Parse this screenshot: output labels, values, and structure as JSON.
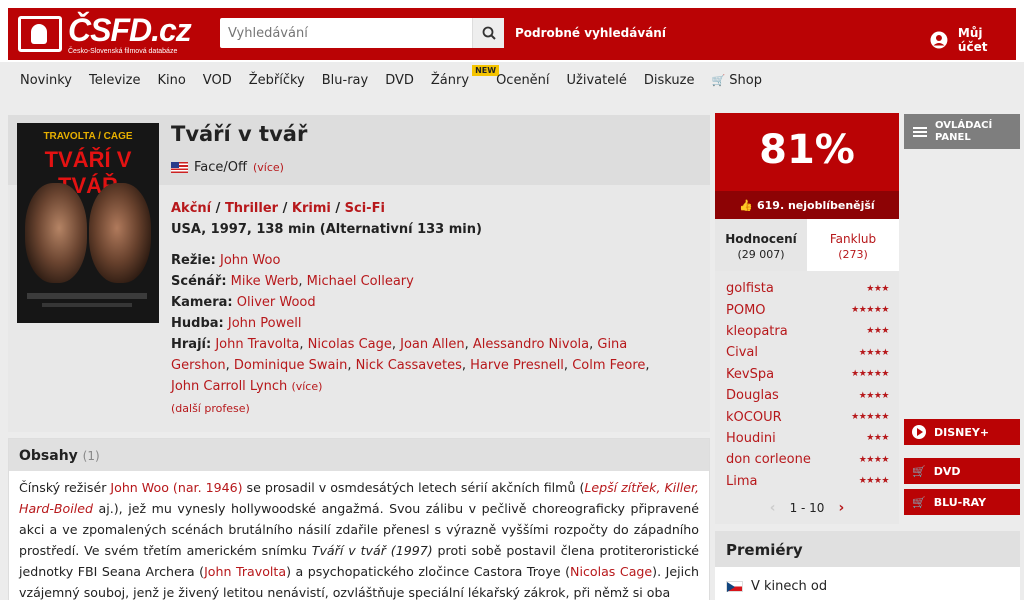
{
  "header": {
    "logo_text": "ČSFD.cz",
    "logo_sub": "Česko-Slovenská filmová databáze",
    "search_placeholder": "Vyhledávání",
    "advanced_search": "Podrobné vyhledávání",
    "account": "Můj účet",
    "brand_color": "#ba0305"
  },
  "nav": {
    "items": [
      "Novinky",
      "Televize",
      "Kino",
      "VOD",
      "Žebříčky",
      "Blu-ray",
      "DVD",
      "Žánry",
      "Ocenění",
      "Uživatelé",
      "Diskuze",
      "Shop"
    ],
    "badge": "NEW"
  },
  "film": {
    "poster_top": "TRAVOLTA / CAGE",
    "poster_title": "TVÁŘÍ V TVÁŘ",
    "title": "Tváří v tvář",
    "original_title": "Face/Off",
    "more": "(více)",
    "genres": [
      "Akční",
      "Thriller",
      "Krimi",
      "Sci-Fi"
    ],
    "genre_sep": " / ",
    "info": "USA, 1997, 138 min (Alternativní 133 min)",
    "creators": {
      "director_label": "Režie:",
      "director": "John Woo",
      "writer_label": "Scénář:",
      "writers": [
        "Mike Werb",
        "Michael Colleary"
      ],
      "camera_label": "Kamera:",
      "camera": "Oliver Wood",
      "music_label": "Hudba:",
      "music": "John Powell",
      "cast_label": "Hrají:",
      "cast": [
        "John Travolta",
        "Nicolas Cage",
        "Joan Allen",
        "Alessandro Nivola",
        "Gina Gershon",
        "Dominique Swain",
        "Nick Cassavetes",
        "Harve Presnell",
        "Colm Feore",
        "John Carroll Lynch"
      ],
      "cast_more": "(více)"
    },
    "more_professions": "(další profese)"
  },
  "plot": {
    "heading": "Obsahy",
    "count": "(1)",
    "p1": "Čínský režisér ",
    "director_link": "John Woo (nar. 1946)",
    "p2": " se prosadil v osmdesátých letech sérií akčních filmů (",
    "films": "Lepší zítřek, Killer, Hard-Boiled",
    "p3": " aj.), jež mu vynesly hollywoodské angažmá. Svou zálibu v pečlivě choreograficky připravené akci a ve zpomalených scénách brutálního násilí zdařile přenesl s výrazně vyššími rozpočty do západního prostředí. Ve svém třetím americkém snímku ",
    "film_title": "Tváří v tvář (1997)",
    "p4": " proti sobě postavil člena protiteroristické jednotky FBI Seana Archera (",
    "actor1": "John Travolta",
    "p5": ") a psychopatického zločince Castora Troye (",
    "actor2": "Nicolas Cage",
    "p6": "). Jejich vzájemný souboj, jenž je živený letitou nenávistí, ozvláštňuje speciální lékařský zákrok, při němž si oba"
  },
  "rating": {
    "percent": "81%",
    "rank": "619. nejoblíbenější",
    "tabs": [
      {
        "label": "Hodnocení",
        "count": "(29 007)"
      },
      {
        "label": "Fanklub",
        "count": "(273)"
      }
    ],
    "users": [
      {
        "name": "golfista",
        "stars": 3
      },
      {
        "name": "POMO",
        "stars": 5
      },
      {
        "name": "kleopatra",
        "stars": 3
      },
      {
        "name": "Cival",
        "stars": 4
      },
      {
        "name": "KevSpa",
        "stars": 5
      },
      {
        "name": "Douglas",
        "stars": 4
      },
      {
        "name": "kOCOUR",
        "stars": 5
      },
      {
        "name": "Houdini",
        "stars": 3
      },
      {
        "name": "don corleone",
        "stars": 4
      },
      {
        "name": "Lima",
        "stars": 4
      }
    ],
    "pager": "1 - 10"
  },
  "side": {
    "panel": "OVLÁDACÍ PANEL",
    "disney": "DISNEY+",
    "dvd": "DVD",
    "bluray": "BLU-RAY"
  },
  "premieres": {
    "heading": "Premiéry",
    "row": "V kinech od"
  }
}
